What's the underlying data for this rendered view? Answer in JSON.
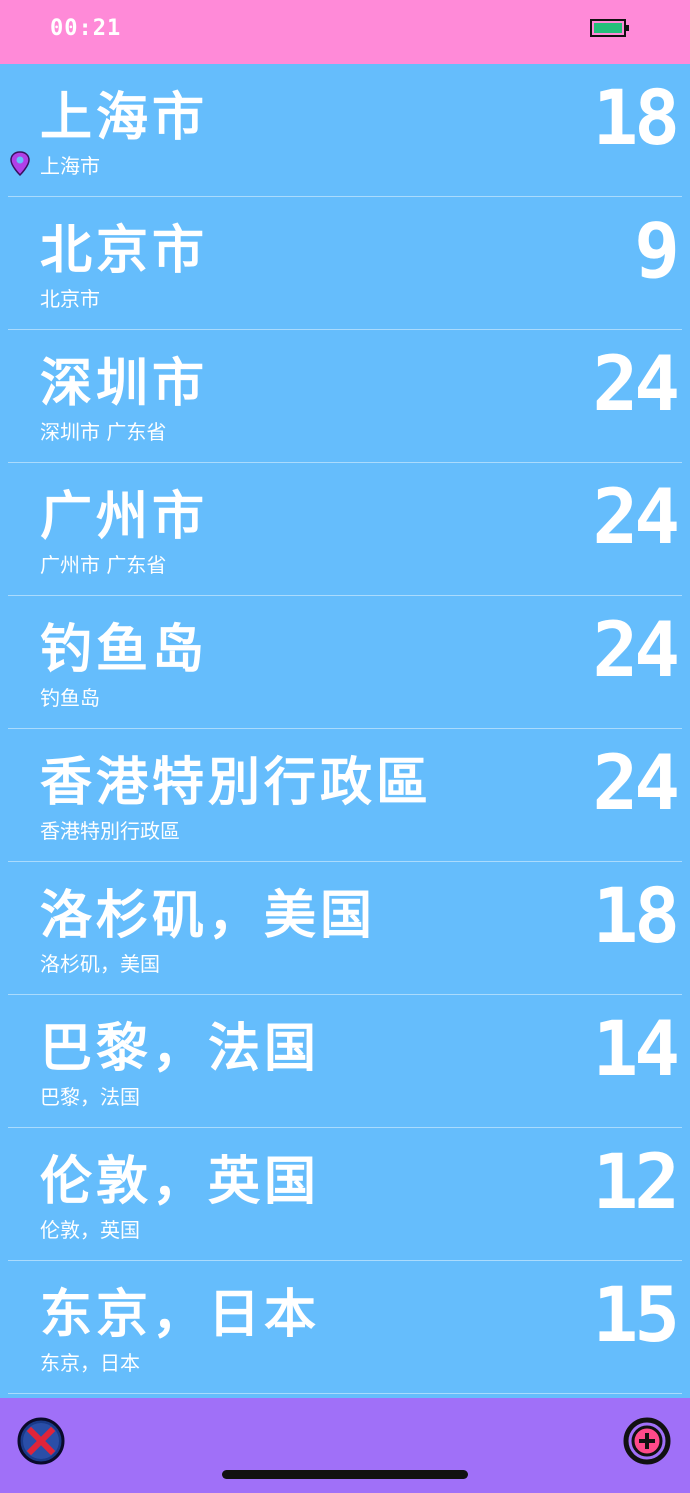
{
  "status_bar": {
    "time": "00:21",
    "battery_color": "#22c07a"
  },
  "cities": [
    {
      "name": "上海市",
      "subtitle": "上海市",
      "temp": "18",
      "current_location": true
    },
    {
      "name": "北京市",
      "subtitle": "北京市",
      "temp": "9"
    },
    {
      "name": "深圳市",
      "subtitle": "深圳市 广东省",
      "temp": "24"
    },
    {
      "name": "广州市",
      "subtitle": "广州市 广东省",
      "temp": "24"
    },
    {
      "name": "钓鱼岛",
      "subtitle": "钓鱼岛",
      "temp": "24"
    },
    {
      "name": "香港特別行政區",
      "subtitle": "香港特別行政區",
      "temp": "24"
    },
    {
      "name": "洛杉矶，美国",
      "subtitle": "洛杉矶，美国",
      "temp": "18"
    },
    {
      "name": "巴黎，法国",
      "subtitle": "巴黎，法国",
      "temp": "14"
    },
    {
      "name": "伦敦，英国",
      "subtitle": "伦敦，英国",
      "temp": "12"
    },
    {
      "name": "东京，日本",
      "subtitle": "东京，日本",
      "temp": "15"
    }
  ],
  "toolbar": {
    "close_icon": "close-icon",
    "add_icon": "add-icon"
  },
  "colors": {
    "status_bar_bg": "#ff8ad8",
    "list_bg": "#65bdfc",
    "toolbar_bg": "#a070f8",
    "close_red": "#e0243a",
    "location_pin": "#b040e8"
  }
}
